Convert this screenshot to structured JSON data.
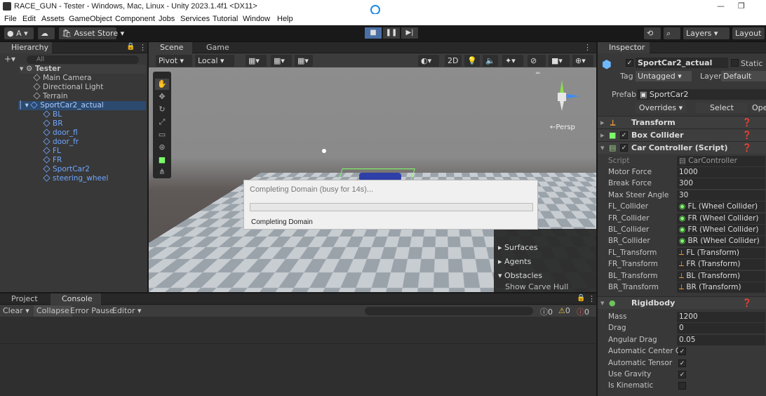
{
  "titlebar": {
    "title": "RACE_GUN - Tester - Windows, Mac, Linux - Unity 2023.1.4f1 <DX11>"
  },
  "menu": [
    "File",
    "Edit",
    "Assets",
    "GameObject",
    "Component",
    "Jobs",
    "Services",
    "Tutorial",
    "Window",
    "Help"
  ],
  "toolbar": {
    "account": "A",
    "asset_store": "Asset Store",
    "layers": "Layers",
    "layout": "Layout"
  },
  "hierarchy": {
    "tab": "Hierarchy",
    "search_placeholder": "All",
    "scene": "Tester",
    "items": [
      "Main Camera",
      "Directional Light",
      "Terrain",
      "SportCar2_actual"
    ],
    "children": [
      "BL",
      "BR",
      "door_fl",
      "door_fr",
      "FL",
      "FR",
      "SportCar2",
      "steering_wheel"
    ]
  },
  "scene": {
    "tabs": [
      "Scene",
      "Game"
    ],
    "pivot": "Pivot",
    "local": "Local",
    "mode_2d": "2D",
    "persp": "←Persp"
  },
  "navigation_overlay": {
    "items": [
      "Surfaces",
      "Agents",
      "Obstacles"
    ],
    "show": "Show Carve Hull"
  },
  "dialog": {
    "title": "Completing Domain (busy for 14s)...",
    "status": "Completing Domain",
    "progress": 0
  },
  "console": {
    "tabs": [
      "Project",
      "Console"
    ],
    "buttons": [
      "Clear",
      "Collapse",
      "Error Pause",
      "Editor"
    ],
    "counts": [
      "0",
      "0",
      "0"
    ]
  },
  "inspector": {
    "tab": "Inspector",
    "object_name": "SportCar2_actual",
    "static": "Static",
    "tag_label": "Tag",
    "tag": "Untagged",
    "layer_label": "Layer",
    "layer": "Default",
    "prefab_label": "Prefab",
    "prefab": "SportCar2",
    "overrides": "Overrides",
    "select": "Select",
    "open": "Open",
    "components": [
      "Transform",
      "Box Collider",
      "Car Controller (Script)",
      "Rigidbody"
    ],
    "script_label": "Script",
    "script": "CarController",
    "fields": [
      {
        "label": "Motor Force",
        "value": "1000"
      },
      {
        "label": "Break Force",
        "value": "300"
      },
      {
        "label": "Max Steer Angle",
        "value": "30"
      },
      {
        "label": "FL_Collider",
        "value": "FL (Wheel Collider)"
      },
      {
        "label": "FR_Collider",
        "value": "FR (Wheel Collider)"
      },
      {
        "label": "BL_Collider",
        "value": "FR (Wheel Collider)"
      },
      {
        "label": "BR_Collider",
        "value": "BR (Wheel Collider)"
      },
      {
        "label": "FL_Transform",
        "value": "FL (Transform)"
      },
      {
        "label": "FR_Transform",
        "value": "FR (Transform)"
      },
      {
        "label": "BL_Transform",
        "value": "BL (Transform)"
      },
      {
        "label": "BR_Transform",
        "value": "BR (Transform)"
      }
    ],
    "rigidbody": [
      {
        "label": "Mass",
        "value": "1200"
      },
      {
        "label": "Drag",
        "value": "0"
      },
      {
        "label": "Angular Drag",
        "value": "0.05"
      },
      {
        "label": "Automatic Center Of",
        "value": "✓"
      },
      {
        "label": "Automatic Tensor",
        "value": "✓"
      },
      {
        "label": "Use Gravity",
        "value": "✓"
      },
      {
        "label": "Is Kinematic",
        "value": ""
      }
    ]
  }
}
